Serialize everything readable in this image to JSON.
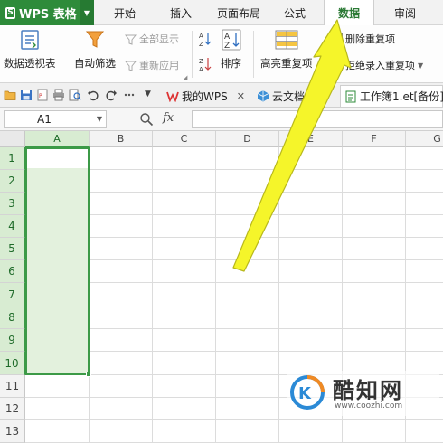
{
  "app": {
    "name": "WPS 表格",
    "logo_letter": "S"
  },
  "menu_tabs": [
    {
      "label": "开始"
    },
    {
      "label": "插入"
    },
    {
      "label": "页面布局"
    },
    {
      "label": "公式"
    },
    {
      "label": "数据",
      "active": true
    },
    {
      "label": "审阅"
    }
  ],
  "ribbon": {
    "pivot_table": "数据透视表",
    "auto_filter": "自动筛选",
    "show_all": "全部显示",
    "reapply": "重新应用",
    "sort": "排序",
    "highlight_duplicates": "高亮重复项",
    "remove_duplicates": "删除重复项",
    "reject_duplicates": "拒绝录入重复项"
  },
  "doc_tabs": [
    {
      "label": "我的WPS"
    },
    {
      "label": "云文档"
    },
    {
      "label": "工作簿1.et[备份]",
      "active": true
    }
  ],
  "formula_bar": {
    "cell_ref": "A1",
    "fx": "fx",
    "formula": ""
  },
  "sheet": {
    "columns": [
      "A",
      "B",
      "C",
      "D",
      "E",
      "F",
      "G"
    ],
    "rows": [
      "1",
      "2",
      "3",
      "4",
      "5",
      "6",
      "7",
      "8",
      "9",
      "10",
      "11",
      "12",
      "13"
    ],
    "selected_range": "A1:A10"
  },
  "annotation": {
    "type": "arrow",
    "color": "#f5f52a",
    "points_to": "数据 tab / 删除重复项"
  },
  "watermark": {
    "title": "酷知网",
    "url": "www.coozhi.com"
  },
  "colors": {
    "brand_green": "#2e8b3a",
    "selection_fill": "#e3f1dd",
    "selection_border": "#3c9a47"
  }
}
